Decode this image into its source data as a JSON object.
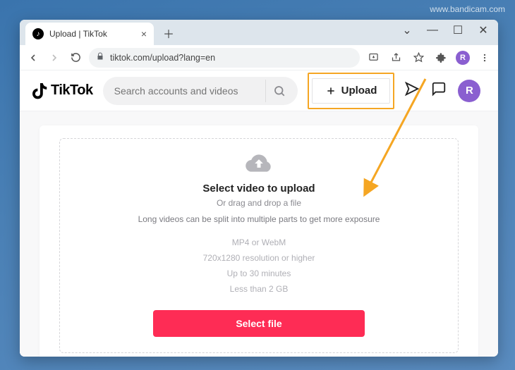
{
  "watermark": "www.bandicam.com",
  "browser": {
    "tab": {
      "title": "Upload | TikTok"
    },
    "url": "tiktok.com/upload?lang=en",
    "avatar_initial": "R"
  },
  "tiktok": {
    "logo_text": "TikTok",
    "search_placeholder": "Search accounts and videos",
    "upload_label": "Upload",
    "avatar_initial": "R"
  },
  "dropzone": {
    "title": "Select video to upload",
    "subtitle": "Or drag and drop a file",
    "note": "Long videos can be split into multiple parts to get more exposure",
    "specs": [
      "MP4 or WebM",
      "720x1280 resolution or higher",
      "Up to 30 minutes",
      "Less than 2 GB"
    ],
    "select_file_label": "Select file"
  }
}
